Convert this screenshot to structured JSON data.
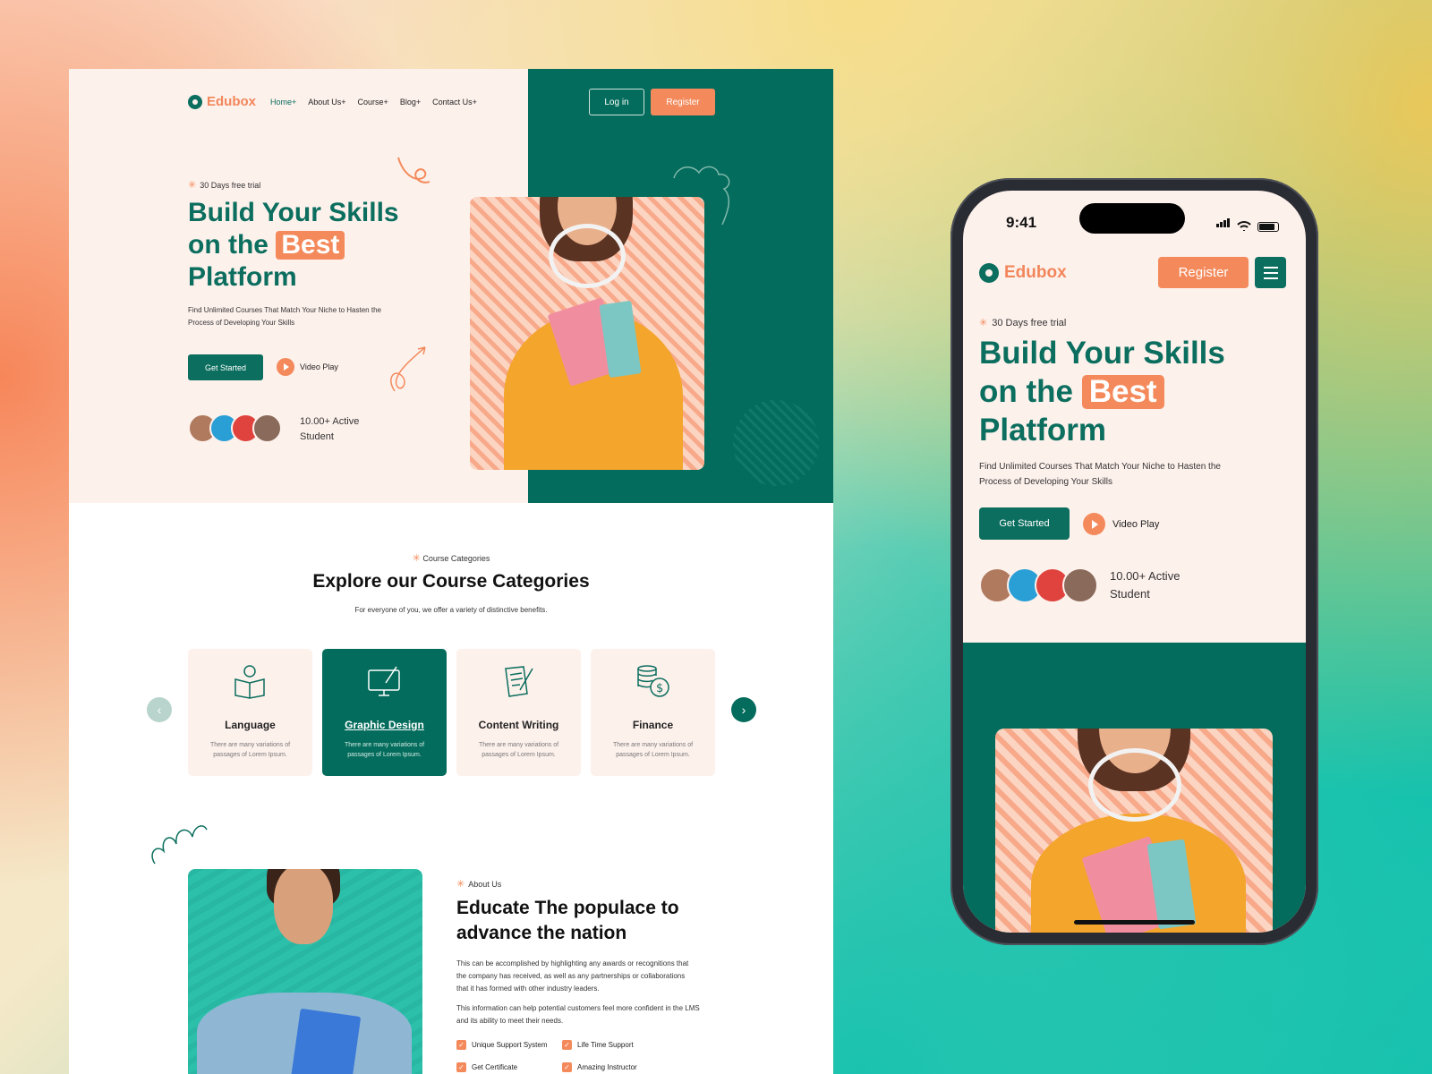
{
  "desktop": {
    "logo": "Edubox",
    "nav": [
      "Home+",
      "About Us+",
      "Course+",
      "Blog+",
      "Contact Us+"
    ],
    "login_label": "Log in",
    "register_label": "Register",
    "hero": {
      "badge": "30 Days free trial",
      "headline_line1": "Build Your Skills",
      "headline_line2": "on the",
      "headline_highlight": "Best",
      "headline_line3": "Platform",
      "subtext": "Find Unlimited Courses That Match Your Niche to Hasten the Process of Developing Your Skills",
      "cta_primary": "Get Started",
      "cta_secondary": "Video Play",
      "students_text": "10.00+ Active Student"
    },
    "categories": {
      "label": "Course Categories",
      "title": "Explore our Course Categories",
      "subtitle": "For everyone of you, we offer a variety of distinctive benefits.",
      "items": [
        {
          "title": "Language",
          "desc": "There are many variations of passages of Lorem Ipsum.",
          "icon": "book-lightbulb-icon"
        },
        {
          "title": "Graphic Design",
          "desc": "There are many variations of passages of Lorem Ipsum.",
          "icon": "monitor-brush-icon"
        },
        {
          "title": "Content Writing",
          "desc": "There are many variations of passages of Lorem Ipsum.",
          "icon": "document-pen-icon"
        },
        {
          "title": "Finance",
          "desc": "There are many variations of passages of Lorem Ipsum.",
          "icon": "coins-dollar-icon"
        }
      ],
      "active_index": 1
    },
    "about": {
      "label": "About Us",
      "title": "Educate The populace to advance the nation",
      "paragraph1": "This can be accomplished by highlighting any awards or recognitions that the company has received, as well as any partnerships or collaborations that it has formed with other industry leaders.",
      "paragraph2": "This information can help potential customers feel more confident in the LMS and its ability to meet their needs.",
      "features": [
        "Unique Support System",
        "Life Time Support",
        "Get Certificate",
        "Amazing Instructor"
      ]
    }
  },
  "mobile": {
    "time": "9:41",
    "logo": "Edubox",
    "register_label": "Register",
    "badge": "30 Days free trial",
    "headline_line1": "Build Your Skills",
    "headline_line2": "on the",
    "headline_highlight": "Best",
    "headline_line3": "Platform",
    "subtext": "Find Unlimited Courses That Match Your Niche to Hasten the Process of Developing Your Skills",
    "cta_primary": "Get Started",
    "cta_secondary": "Video Play",
    "students_text": "10.00+ Active Student"
  },
  "colors": {
    "brand_green": "#046c5c",
    "accent_orange": "#f48a5b",
    "hero_bg": "#fdf1ec"
  }
}
